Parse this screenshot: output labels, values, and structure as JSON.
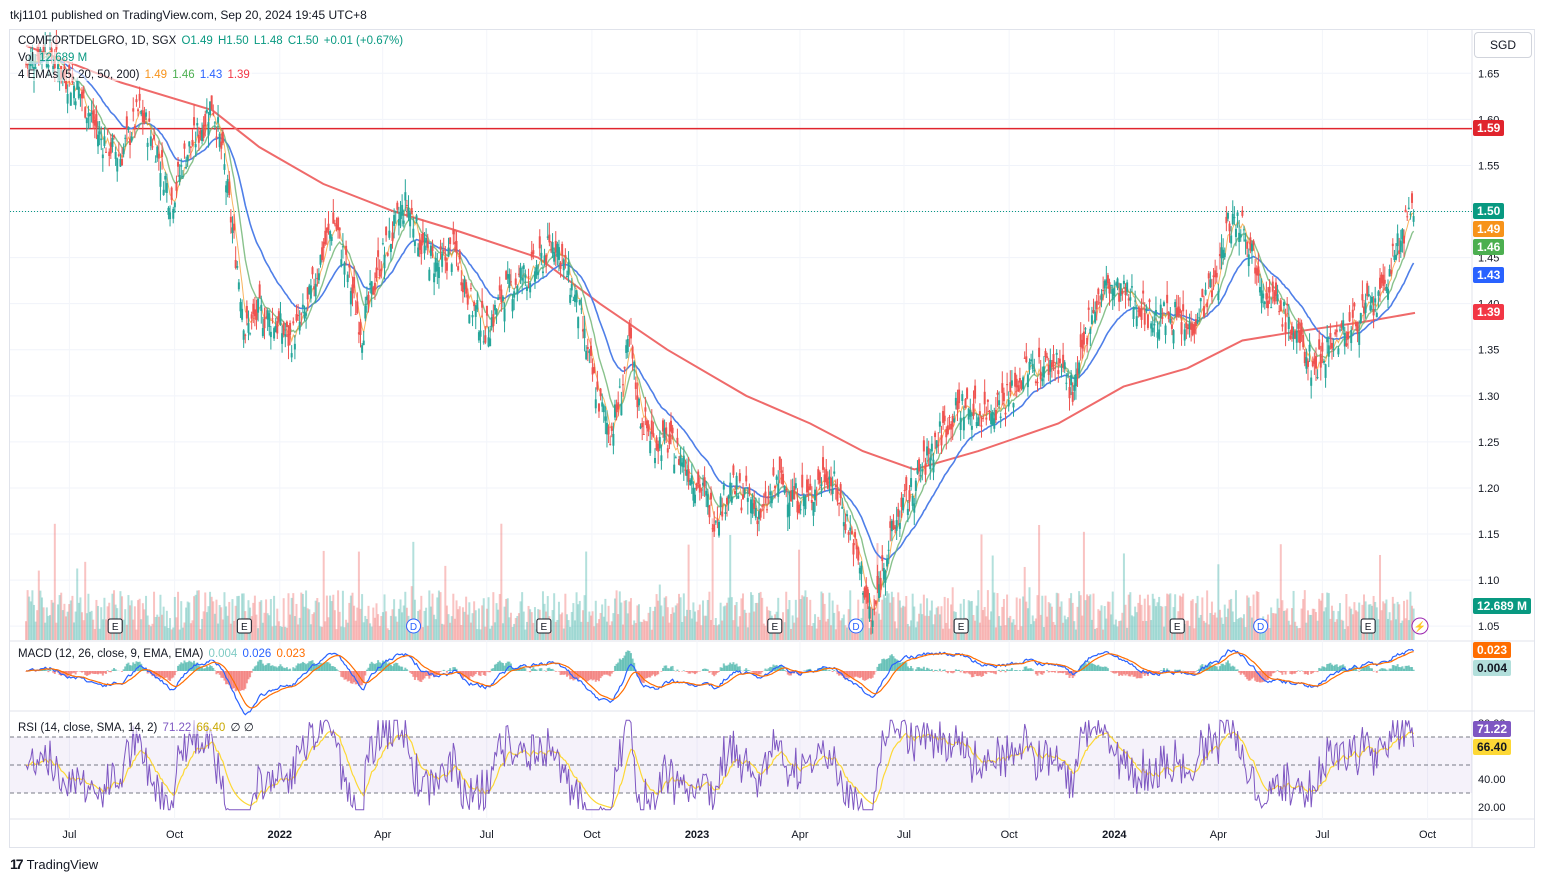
{
  "published": "tkj1101 published on TradingView.com, Sep 20, 2024 19:45 UTC+8",
  "brand": "TradingView",
  "currency_button": "SGD",
  "header": {
    "symbol": "COMFORTDELGRO, 1D, SGX",
    "open": "O1.49",
    "high": "H1.50",
    "low": "L1.48",
    "close": "C1.50",
    "change": "+0.01 (+0.67%)",
    "vol_label": "Vol",
    "vol_value": "12.689 M",
    "ema_label": "4 EMAs (5, 20, 50, 200)",
    "ema5": "1.49",
    "ema20": "1.46",
    "ema50": "1.43",
    "ema200": "1.39"
  },
  "macd_legend": {
    "label": "MACD (12, 26, close, 9, EMA, EMA)",
    "hist": "0.004",
    "macd": "0.026",
    "signal": "0.023"
  },
  "rsi_legend": {
    "label": "RSI (14, close, SMA, 14, 2)",
    "rsi": "71.22",
    "sma": "66.40",
    "extra": "∅ ∅"
  },
  "colors": {
    "up": "#26a69a",
    "down": "#ef5350",
    "ema5": "#f7931a",
    "ema20": "#6bb36f",
    "ema50": "#4f7fe8",
    "ema200": "#ef6a6a",
    "hline": "#e0242d",
    "macd": "#2962ff",
    "signal": "#ff6d00",
    "rsi": "#7e57c2",
    "rsi_sma": "#fdd835"
  },
  "price_badges": [
    {
      "label": "1.59",
      "value": 1.59,
      "color": "#e0242d"
    },
    {
      "label": "1.50",
      "value": 1.5,
      "color": "#089981"
    },
    {
      "label": "1.49",
      "value": 1.49,
      "color": "#f7931a"
    },
    {
      "label": "1.46",
      "value": 1.46,
      "color": "#4caf50"
    },
    {
      "label": "1.43",
      "value": 1.43,
      "color": "#2962ff"
    },
    {
      "label": "1.39",
      "value": 1.39,
      "color": "#f23645"
    }
  ],
  "volume_badge": "12.689 M",
  "macd_badges": [
    {
      "label": "0.023",
      "color": "#ff6d00"
    },
    {
      "label": "0.004",
      "color": "#b2dfdb"
    }
  ],
  "rsi_badges": [
    {
      "label": "71.22",
      "color": "#7e57c2"
    },
    {
      "label": "66.40",
      "color": "#fdd835"
    }
  ],
  "chart_data": {
    "type": "candlestick",
    "symbol": "COMFORTDELGRO",
    "interval": "1D",
    "exchange": "SGX",
    "price_axis": {
      "ticks": [
        "1.65",
        "1.60",
        "1.55",
        "1.50",
        "1.45",
        "1.40",
        "1.35",
        "1.30",
        "1.25",
        "1.20",
        "1.15",
        "1.10",
        "1.05"
      ],
      "range": [
        1.035,
        1.697
      ]
    },
    "time_axis": {
      "ticks": [
        "Jul",
        "Oct",
        "2022",
        "Apr",
        "Jul",
        "Oct",
        "2023",
        "Apr",
        "Jul",
        "Oct",
        "2024",
        "Apr",
        "Jul",
        "Oct"
      ],
      "bold": [
        "2022",
        "2023",
        "2024"
      ]
    },
    "horizontal_line": 1.59,
    "last_price_line": 1.5,
    "close_series": [
      [
        "2021-05-24",
        1.66
      ],
      [
        "2021-06-10",
        1.68
      ],
      [
        "2021-06-25",
        1.65
      ],
      [
        "2021-07-10",
        1.63
      ],
      [
        "2021-07-28",
        1.58
      ],
      [
        "2021-08-15",
        1.56
      ],
      [
        "2021-08-31",
        1.61
      ],
      [
        "2021-09-15",
        1.57
      ],
      [
        "2021-09-28",
        1.51
      ],
      [
        "2021-10-10",
        1.56
      ],
      [
        "2021-10-24",
        1.59
      ],
      [
        "2021-11-03",
        1.62
      ],
      [
        "2021-11-12",
        1.56
      ],
      [
        "2021-11-25",
        1.44
      ],
      [
        "2021-12-02",
        1.37
      ],
      [
        "2021-12-14",
        1.39
      ],
      [
        "2021-12-28",
        1.38
      ],
      [
        "2022-01-10",
        1.36
      ],
      [
        "2022-01-24",
        1.39
      ],
      [
        "2022-02-08",
        1.46
      ],
      [
        "2022-02-18",
        1.49
      ],
      [
        "2022-03-02",
        1.43
      ],
      [
        "2022-03-14",
        1.37
      ],
      [
        "2022-03-28",
        1.44
      ],
      [
        "2022-04-11",
        1.48
      ],
      [
        "2022-04-22",
        1.51
      ],
      [
        "2022-05-06",
        1.46
      ],
      [
        "2022-05-20",
        1.44
      ],
      [
        "2022-06-03",
        1.46
      ],
      [
        "2022-06-17",
        1.4
      ],
      [
        "2022-07-01",
        1.37
      ],
      [
        "2022-07-15",
        1.41
      ],
      [
        "2022-08-01",
        1.43
      ],
      [
        "2022-08-15",
        1.44
      ],
      [
        "2022-08-30",
        1.47
      ],
      [
        "2022-09-10",
        1.43
      ],
      [
        "2022-09-20",
        1.39
      ],
      [
        "2022-09-28",
        1.34
      ],
      [
        "2022-10-08",
        1.29
      ],
      [
        "2022-10-18",
        1.26
      ],
      [
        "2022-10-26",
        1.3
      ],
      [
        "2022-11-03",
        1.36
      ],
      [
        "2022-11-12",
        1.28
      ],
      [
        "2022-11-24",
        1.25
      ],
      [
        "2022-12-06",
        1.25
      ],
      [
        "2022-12-20",
        1.23
      ],
      [
        "2023-01-04",
        1.2
      ],
      [
        "2023-01-16",
        1.17
      ],
      [
        "2023-01-30",
        1.2
      ],
      [
        "2023-02-13",
        1.19
      ],
      [
        "2023-02-27",
        1.17
      ],
      [
        "2023-03-13",
        1.21
      ],
      [
        "2023-03-27",
        1.19
      ],
      [
        "2023-04-10",
        1.19
      ],
      [
        "2023-04-24",
        1.22
      ],
      [
        "2023-05-05",
        1.19
      ],
      [
        "2023-05-16",
        1.15
      ],
      [
        "2023-05-26",
        1.1
      ],
      [
        "2023-06-03",
        1.05
      ],
      [
        "2023-06-13",
        1.12
      ],
      [
        "2023-06-26",
        1.17
      ],
      [
        "2023-07-10",
        1.2
      ],
      [
        "2023-07-24",
        1.24
      ],
      [
        "2023-08-07",
        1.27
      ],
      [
        "2023-08-21",
        1.29
      ],
      [
        "2023-09-04",
        1.28
      ],
      [
        "2023-09-18",
        1.29
      ],
      [
        "2023-10-02",
        1.3
      ],
      [
        "2023-10-16",
        1.33
      ],
      [
        "2023-10-30",
        1.33
      ],
      [
        "2023-11-13",
        1.34
      ],
      [
        "2023-11-27",
        1.3
      ],
      [
        "2023-12-11",
        1.39
      ],
      [
        "2023-12-26",
        1.42
      ],
      [
        "2024-01-09",
        1.41
      ],
      [
        "2024-01-23",
        1.4
      ],
      [
        "2024-02-06",
        1.38
      ],
      [
        "2024-02-20",
        1.39
      ],
      [
        "2024-03-05",
        1.37
      ],
      [
        "2024-03-18",
        1.4
      ],
      [
        "2024-04-01",
        1.43
      ],
      [
        "2024-04-10",
        1.49
      ],
      [
        "2024-04-22",
        1.49
      ],
      [
        "2024-05-03",
        1.45
      ],
      [
        "2024-05-14",
        1.41
      ],
      [
        "2024-05-27",
        1.39
      ],
      [
        "2024-06-10",
        1.36
      ],
      [
        "2024-06-24",
        1.33
      ],
      [
        "2024-07-08",
        1.36
      ],
      [
        "2024-07-22",
        1.37
      ],
      [
        "2024-08-05",
        1.39
      ],
      [
        "2024-08-19",
        1.4
      ],
      [
        "2024-08-30",
        1.44
      ],
      [
        "2024-09-10",
        1.48
      ],
      [
        "2024-09-20",
        1.5
      ]
    ],
    "ema200_series": [
      [
        "2021-05-24",
        1.68
      ],
      [
        "2021-08-15",
        1.64
      ],
      [
        "2021-11-03",
        1.61
      ],
      [
        "2021-12-14",
        1.57
      ],
      [
        "2022-02-08",
        1.53
      ],
      [
        "2022-04-11",
        1.5
      ],
      [
        "2022-06-03",
        1.48
      ],
      [
        "2022-08-15",
        1.45
      ],
      [
        "2022-10-08",
        1.4
      ],
      [
        "2022-12-06",
        1.35
      ],
      [
        "2023-02-13",
        1.3
      ],
      [
        "2023-04-10",
        1.27
      ],
      [
        "2023-05-26",
        1.24
      ],
      [
        "2023-07-10",
        1.22
      ],
      [
        "2023-09-04",
        1.24
      ],
      [
        "2023-11-13",
        1.27
      ],
      [
        "2024-01-09",
        1.31
      ],
      [
        "2024-03-05",
        1.33
      ],
      [
        "2024-04-22",
        1.36
      ],
      [
        "2024-06-10",
        1.37
      ],
      [
        "2024-08-05",
        1.38
      ],
      [
        "2024-09-20",
        1.39
      ]
    ],
    "macd_axis": {
      "ticks": []
    },
    "rsi_axis": {
      "ticks": [
        "80.00",
        "40.00",
        "20.00"
      ],
      "bands": [
        70,
        50,
        30
      ]
    },
    "last_values": {
      "volume": "12.689 M",
      "ema5": 1.49,
      "ema20": 1.46,
      "ema50": 1.43,
      "ema200": 1.39,
      "macd": 0.026,
      "signal": 0.023,
      "hist": 0.004,
      "rsi": 71.22,
      "rsi_sma": 66.4
    },
    "events": [
      {
        "date": "2021-08-10",
        "type": "E"
      },
      {
        "date": "2021-12-01",
        "type": "E"
      },
      {
        "date": "2022-04-28",
        "type": "D"
      },
      {
        "date": "2022-08-20",
        "type": "E"
      },
      {
        "date": "2023-03-10",
        "type": "E"
      },
      {
        "date": "2023-05-20",
        "type": "D"
      },
      {
        "date": "2023-08-20",
        "type": "E"
      },
      {
        "date": "2024-02-25",
        "type": "E"
      },
      {
        "date": "2024-05-08",
        "type": "D"
      },
      {
        "date": "2024-08-10",
        "type": "E"
      }
    ]
  }
}
